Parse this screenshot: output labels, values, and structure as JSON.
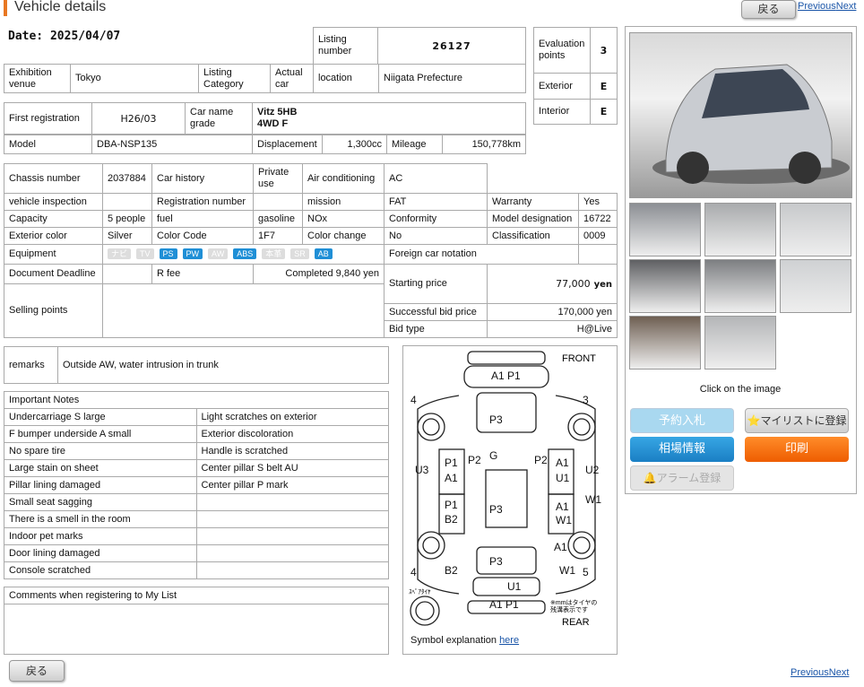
{
  "header": {
    "title": "Vehicle details",
    "back_label": "戻る",
    "prev_label": "Previous",
    "next_label": "Next"
  },
  "date": "Date: 2025/04/07",
  "listing": {
    "label": "Listing number",
    "value": "26127"
  },
  "evaluation": [
    {
      "label": "Evaluation points",
      "value": "3"
    },
    {
      "label": "Exterior",
      "value": "E"
    },
    {
      "label": "Interior",
      "value": "E"
    }
  ],
  "venue": {
    "exhibition_label": "Exhibition venue",
    "exhibition_value": "Tokyo",
    "category_label": "Listing Category",
    "actual_label": "Actual car",
    "location_label": "location",
    "location_value": "Niigata Prefecture"
  },
  "first_reg": {
    "label": "First registration",
    "value": "H26/03",
    "grade_label": "Car name grade",
    "grade_line1": "Vitz 5HB",
    "grade_line2": "4WD F"
  },
  "model_row": {
    "model_label": "Model",
    "model_value": "DBA-NSP135",
    "disp_label": "Displacement",
    "disp_value": "1,300cc",
    "mileage_label": "Mileage",
    "mileage_value": "150,778km"
  },
  "specs": {
    "chassis_label": "Chassis number",
    "chassis_value": "2037884",
    "history_label": "Car history",
    "private_use": "Private use",
    "aircon_label": "Air conditioning",
    "aircon_value": "AC",
    "inspection_label": "vehicle inspection",
    "regno_label": "Registration number",
    "mission_label": "mission",
    "mission_value": "FAT",
    "warranty_label": "Warranty",
    "warranty_value": "Yes",
    "capacity_label": "Capacity",
    "capacity_value": "5 people",
    "fuel_label": "fuel",
    "fuel_value": "gasoline",
    "nox_label": "NOx",
    "conformity_label": "Conformity",
    "designation_label": "Model designation",
    "designation_value": "16722",
    "ext_color_label": "Exterior color",
    "ext_color_value": "Silver",
    "color_code_label": "Color Code",
    "color_code_value": "1F7",
    "color_change_label": "Color change",
    "color_change_value": "No",
    "classification_label": "Classification",
    "classification_value": "0009",
    "equipment_label": "Equipment",
    "foreign_label": "Foreign car notation",
    "deadline_label": "Document Deadline",
    "rfee_label": "R fee",
    "rfee_value": "Completed 9,840 yen",
    "selling_label": "Selling points",
    "starting_label": "Starting price",
    "starting_value": "77,000",
    "yen": "yen",
    "successful_label": "Successful bid price",
    "successful_value": "170,000 yen",
    "bidtype_label": "Bid type",
    "bidtype_value": "H@Live"
  },
  "equipment": [
    {
      "label": "ナビ",
      "on": false
    },
    {
      "label": "TV",
      "on": false
    },
    {
      "label": "PS",
      "on": true
    },
    {
      "label": "PW",
      "on": true
    },
    {
      "label": "AW",
      "on": false
    },
    {
      "label": "ABS",
      "on": true
    },
    {
      "label": "本革",
      "on": false
    },
    {
      "label": "SR",
      "on": false
    },
    {
      "label": "AB",
      "on": true
    }
  ],
  "remarks": {
    "label": "remarks",
    "value": "Outside AW, water intrusion in trunk"
  },
  "notes": {
    "header": "Important Notes",
    "rows": [
      [
        "Undercarriage S large",
        "Light scratches on exterior"
      ],
      [
        "F bumper underside A small",
        "Exterior discoloration"
      ],
      [
        "No spare tire",
        "Handle is scratched"
      ],
      [
        "Large stain on sheet",
        "Center pillar S belt AU"
      ],
      [
        "Pillar lining damaged",
        "Center pillar P mark"
      ],
      [
        "Small seat sagging",
        ""
      ],
      [
        "There is a smell in the room",
        ""
      ],
      [
        "Indoor pet marks",
        ""
      ],
      [
        "Door lining damaged",
        ""
      ],
      [
        "Console scratched",
        ""
      ]
    ]
  },
  "comments": {
    "label": "Comments when registering to My List"
  },
  "diagram": {
    "front": "FRONT",
    "rear": "REAR",
    "spare": "ｽﾍﾟｱﾀｲﾔ",
    "mm": "mm",
    "tire_note1": "※mmはタイヤの",
    "tire_note2": "残溝表示です",
    "symbol_text": "Symbol explanation ",
    "symbol_link": "here",
    "marks": [
      "A1 P1",
      "P3",
      "G",
      "P2",
      "P2",
      "P1",
      "A1",
      "P1",
      "B2",
      "A1",
      "U1",
      "A1",
      "W1",
      "U3",
      "U2",
      "W1",
      "P3",
      "A1",
      "W1",
      "B2",
      "P3",
      "U1",
      "A1 P1",
      "4",
      "3",
      "4",
      "5"
    ]
  },
  "photos": {
    "caption": "Click on the image"
  },
  "actions": {
    "reserve": "予約入札",
    "mylist": "⭐マイリストに登録",
    "market": "相場情報",
    "print": "印刷",
    "alarm": "🔔アラーム登録"
  }
}
